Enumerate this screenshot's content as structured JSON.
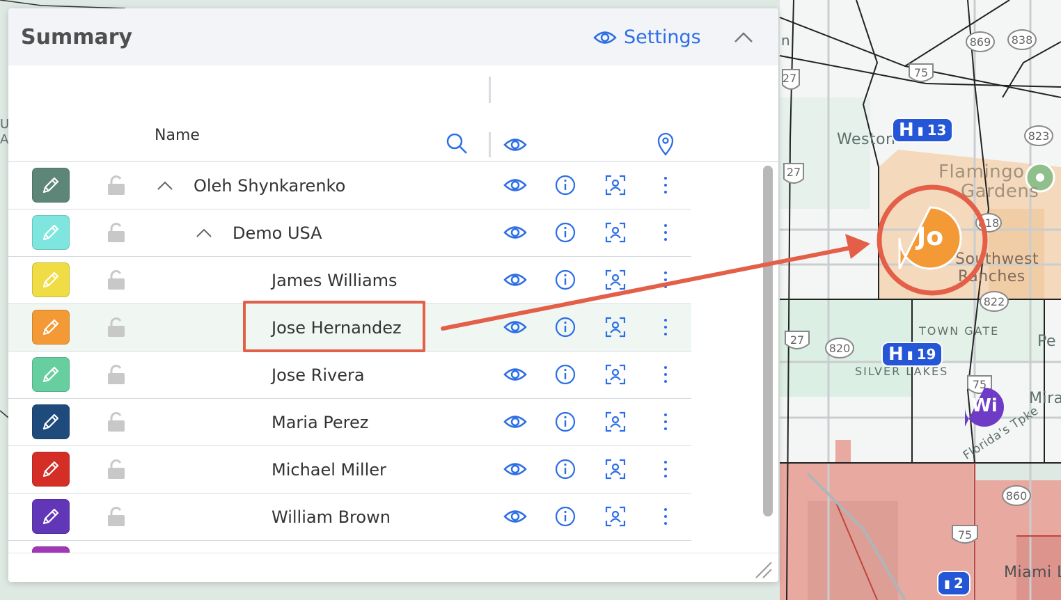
{
  "panel": {
    "title": "Summary",
    "settings_label": "Settings",
    "column_name": "Name"
  },
  "rows": [
    {
      "name": "Oleh Shynkarenko",
      "color": "#5e8678",
      "level": 0,
      "expanded": true
    },
    {
      "name": "Demo USA",
      "color": "#7ee6df",
      "level": 1,
      "expanded": true
    },
    {
      "name": "James Williams",
      "color": "#f0dc45",
      "level": 2
    },
    {
      "name": "Jose Hernandez",
      "color": "#f39a36",
      "level": 2,
      "selected": true
    },
    {
      "name": "Jose Rivera",
      "color": "#66ce9f",
      "level": 2
    },
    {
      "name": "Maria Perez",
      "color": "#1e4a7c",
      "level": 2
    },
    {
      "name": "Michael Miller",
      "color": "#d42e27",
      "level": 2
    },
    {
      "name": "William Brown",
      "color": "#6137b8",
      "level": 2
    }
  ],
  "map": {
    "labels": {
      "weston": "Weston",
      "flamingo": "Flamingo",
      "gardens": "Gardens",
      "southwest": "Southwest",
      "ranches": "Ranches",
      "town_gate": "TOWN GATE",
      "silver_lakes": "SILVER LAKES",
      "mira": "Mira",
      "miami": "Miami L",
      "florida_tpke": "Florida's Tpke",
      "pe": "Pe",
      "u": "U",
      "a": "A",
      "n": "n"
    },
    "shields": [
      "869",
      "838",
      "75",
      "27",
      "823",
      "818",
      "822",
      "27",
      "820",
      "75",
      "860",
      "75"
    ],
    "badges": [
      {
        "letter": "H",
        "count": "13"
      },
      {
        "letter": "H",
        "count": "19"
      },
      {
        "count": "2"
      }
    ],
    "markers": {
      "jo": "Jo",
      "wi": "Wi"
    },
    "accent": "#e35f48"
  }
}
